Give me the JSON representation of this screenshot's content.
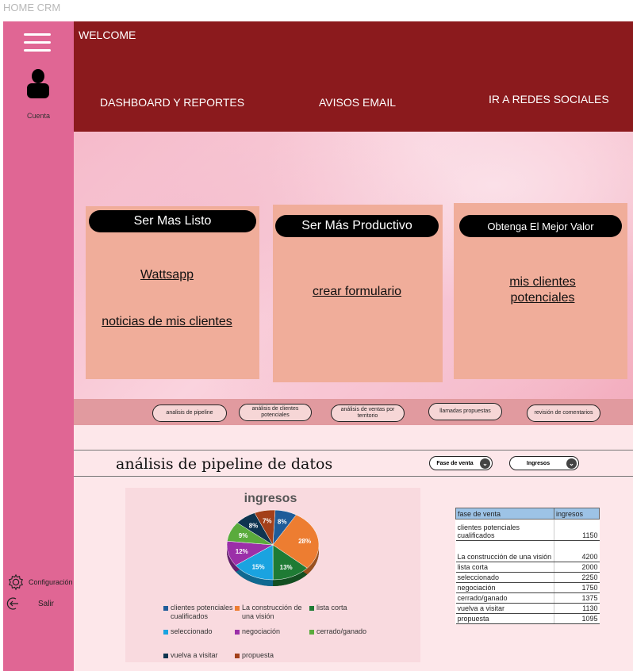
{
  "app": {
    "title": "HOME CRM"
  },
  "sidebar": {
    "account_label": "Cuenta",
    "menu_icon": "hamburger-menu-icon",
    "avatar_icon": "user-icon",
    "items": [
      {
        "label": "Configuración",
        "icon": "gear-icon"
      },
      {
        "label": "Salir",
        "icon": "logout-icon"
      }
    ]
  },
  "header": {
    "welcome": "WELCOME",
    "nav": [
      "DASHBOARD Y REPORTES",
      "AVISOS EMAIL",
      "IR A REDES SOCIALES"
    ]
  },
  "cards": [
    {
      "title": "Ser Mas Listo",
      "links": [
        "Wattsapp",
        "noticias de mis clientes"
      ]
    },
    {
      "title": "Ser Más Productivo",
      "links": [
        "crear formulario"
      ]
    },
    {
      "title": "Obtenga El Mejor Valor",
      "links": [
        "mis clientes potenciales"
      ]
    }
  ],
  "tabs": [
    "analisis de pipeline",
    "análisis de clientes potenciales",
    "análisis de ventas por territorio",
    "llamadas propuestas",
    "revisión de comentarios"
  ],
  "pipeline": {
    "title": "análisis de pipeline de datos",
    "dropdown_1": "Fase de venta",
    "dropdown_2": "Ingresos"
  },
  "chart_data": {
    "type": "pie",
    "title": "ingresos",
    "categories": [
      "clientes potenciales cualificados",
      "La construcción de una visión",
      "lista corta",
      "seleccionado",
      "negociación",
      "cerrado/ganado",
      "vuelva a visitar",
      "propuesta"
    ],
    "values": [
      1150,
      4200,
      2000,
      2250,
      1750,
      1375,
      1130,
      1095
    ],
    "percent_labels": [
      "8%",
      "28%",
      "13%",
      "15%",
      "12%",
      "9%",
      "8%",
      "7%"
    ],
    "colors": [
      "#1f5c99",
      "#ed7d31",
      "#1e7b34",
      "#1aa3e0",
      "#9b2fa8",
      "#5aab3c",
      "#0f3550",
      "#a3401a"
    ],
    "legend_position": "bottom"
  },
  "table": {
    "headers": [
      "fase de venta",
      "ingresos"
    ],
    "rows": [
      [
        "clientes potenciales cualificados",
        "1150"
      ],
      [
        "La construcción de una visión",
        "4200"
      ],
      [
        "lista corta",
        "2000"
      ],
      [
        "seleccionado",
        "2250"
      ],
      [
        "negociación",
        "1750"
      ],
      [
        "cerrado/ganado",
        "1375"
      ],
      [
        "vuelva a visitar",
        "1130"
      ],
      [
        "propuesta",
        "1095"
      ]
    ]
  }
}
